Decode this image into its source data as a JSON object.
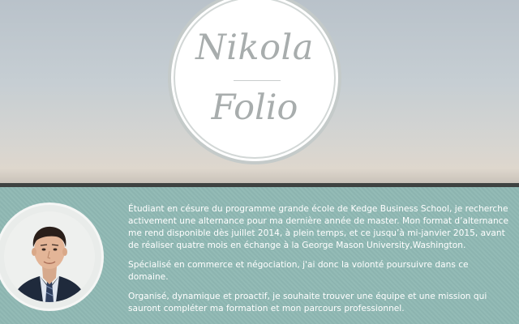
{
  "logo": {
    "line1": "Nikola",
    "line2": "Folio"
  },
  "profile": {
    "photo_alt": "Portrait",
    "paragraphs": [
      "Étudiant en césure du programme grande école de Kedge Business School, je recherche activement une alternance pour ma dernière année de master. Mon format d’alternance me rend disponible dès juillet 2014, à plein temps, et ce jusqu’à mi-janvier 2015, avant de réaliser quatre mois en échange à la George Mason University,Washington.",
      "Spécialisé en commerce et négociation, j'ai donc la volonté poursuivre dans ce domaine.",
      "Organisé, dynamique et proactif, je souhaite trouver une équipe et une mission qui sauront compléter ma formation et mon parcours professionnel."
    ]
  },
  "colors": {
    "hero_sky": "#c6ced3",
    "band": "#3e4241",
    "about_bg": "#8fb8b3",
    "logo_text": "#a8adad"
  }
}
